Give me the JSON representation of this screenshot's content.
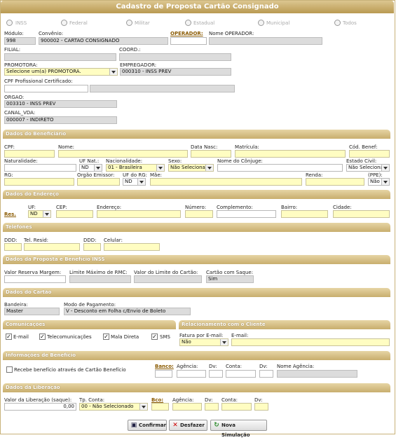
{
  "title": "Cadastro de Proposta Cartão Consignado",
  "radios": [
    "INSS",
    "Federal",
    "Militar",
    "Estadual",
    "Municipal",
    "Todos"
  ],
  "top": {
    "modulo_label": "Módulo:",
    "modulo_value": "998",
    "convenio_label": "Convênio:",
    "convenio_value": "900002 - CARTAO CONSIGNADO",
    "operador_label": "OPERADOR:",
    "operador_value": "",
    "nome_operador_label": "Nome OPERADOR:",
    "filial_label": "FILIAL:",
    "coord_label": "COORD.:",
    "promotora_label": "PROMOTORA:",
    "promotora_value": "Selecione um(a) PROMOTORA.",
    "empregador_label": "EMPREGADOR:",
    "empregador_value": "000310 - INSS PREV",
    "cpf_prof_label": "CPF Profissional Certificado:",
    "orgao_label": "ORGAO:",
    "orgao_value": "003310 - INSS PREV",
    "canal_label": "CANAL_VDA:",
    "canal_value": "000007 - INDIRETO"
  },
  "beneficiario": {
    "header": "Dados do Beneficiário",
    "cpf": "CPF:",
    "nome": "Nome:",
    "data_nasc": "Data Nasc:",
    "matricula": "Matrícula:",
    "cod_benef": "Cód. Benef:",
    "naturalidade": "Naturalidade:",
    "uf_nat": "UF Nat.:",
    "uf_nat_value": "ND",
    "nacionalidade": "Nacionalidade:",
    "nacionalidade_value": "01 - Brasileira",
    "sexo": "Sexo:",
    "sexo_value": "Não Selecionado",
    "conjuge": "Nome do Cônjuge:",
    "estado_civil": "Estado Civil:",
    "estado_civil_value": "Não Selecionado",
    "rg": "RG:",
    "orgao_emissor": "Orgão Emissor:",
    "uf_rg": "UF do RG:",
    "uf_rg_value": "ND",
    "mae": "Mãe:",
    "renda": "Renda:",
    "ppe": "(PPE):",
    "ppe_value": "Não"
  },
  "endereco": {
    "header": "Dados do Endereço",
    "res": "Res.",
    "uf": "UF:",
    "uf_value": "ND",
    "cep": "CEP:",
    "endereco": "Endereço:",
    "numero": "Número:",
    "complemento": "Complemento:",
    "bairro": "Bairro:",
    "cidade": "Cidade:"
  },
  "telefones": {
    "header": "Telefones",
    "ddd1": "DDD:",
    "tel": "Tel. Resid:",
    "ddd2": "DDD:",
    "celular": "Celular:"
  },
  "proposta": {
    "header": "Dados da Proposta e Benefício INSS",
    "reserva": "Valor Reserva Margem:",
    "limite": "Limite Máximo de RMC:",
    "valor_limite": "Valor do Limite do Cartão:",
    "saque": "Cartão com Saque:",
    "saque_value": "Sim"
  },
  "cartao": {
    "header": "Dados do Cartão",
    "bandeira": "Bandeira:",
    "bandeira_value": "Master",
    "modo": "Modo de Pagamento:",
    "modo_value": "V - Desconto em Folha c/Envio de Boleto"
  },
  "comunicacoes": {
    "header": "Comunicações",
    "items": [
      "E-mail",
      "Telecomunicações",
      "Mala Direta",
      "SMS"
    ]
  },
  "relacionamento": {
    "header": "Relacionamento com o Cliente",
    "fatura": "Fatura por E-mail:",
    "fatura_value": "Não",
    "email": "E-mail:"
  },
  "beneficio": {
    "header": "Informações de Benefício",
    "recebe": "Recebe benefício através de Cartão Benefício",
    "banco": "Banco:",
    "agencia": "Agência:",
    "dv1": "Dv:",
    "conta": "Conta:",
    "dv2": "Dv:",
    "nome_agencia": "Nome Agência:"
  },
  "liberacao": {
    "header": "Dados da Liberação",
    "valor": "Valor da Liberação (saque):",
    "valor_value": "0,00",
    "tp_conta": "Tp. Conta:",
    "tp_conta_value": "00 - Não Selecionado",
    "bco": "Bco:",
    "agencia": "Agência:",
    "dv1": "Dv:",
    "conta": "Conta:",
    "dv2": "Dv:"
  },
  "buttons": {
    "confirmar": "Confirmar",
    "desfazer": "Desfazer",
    "nova": "Nova Simulação"
  }
}
